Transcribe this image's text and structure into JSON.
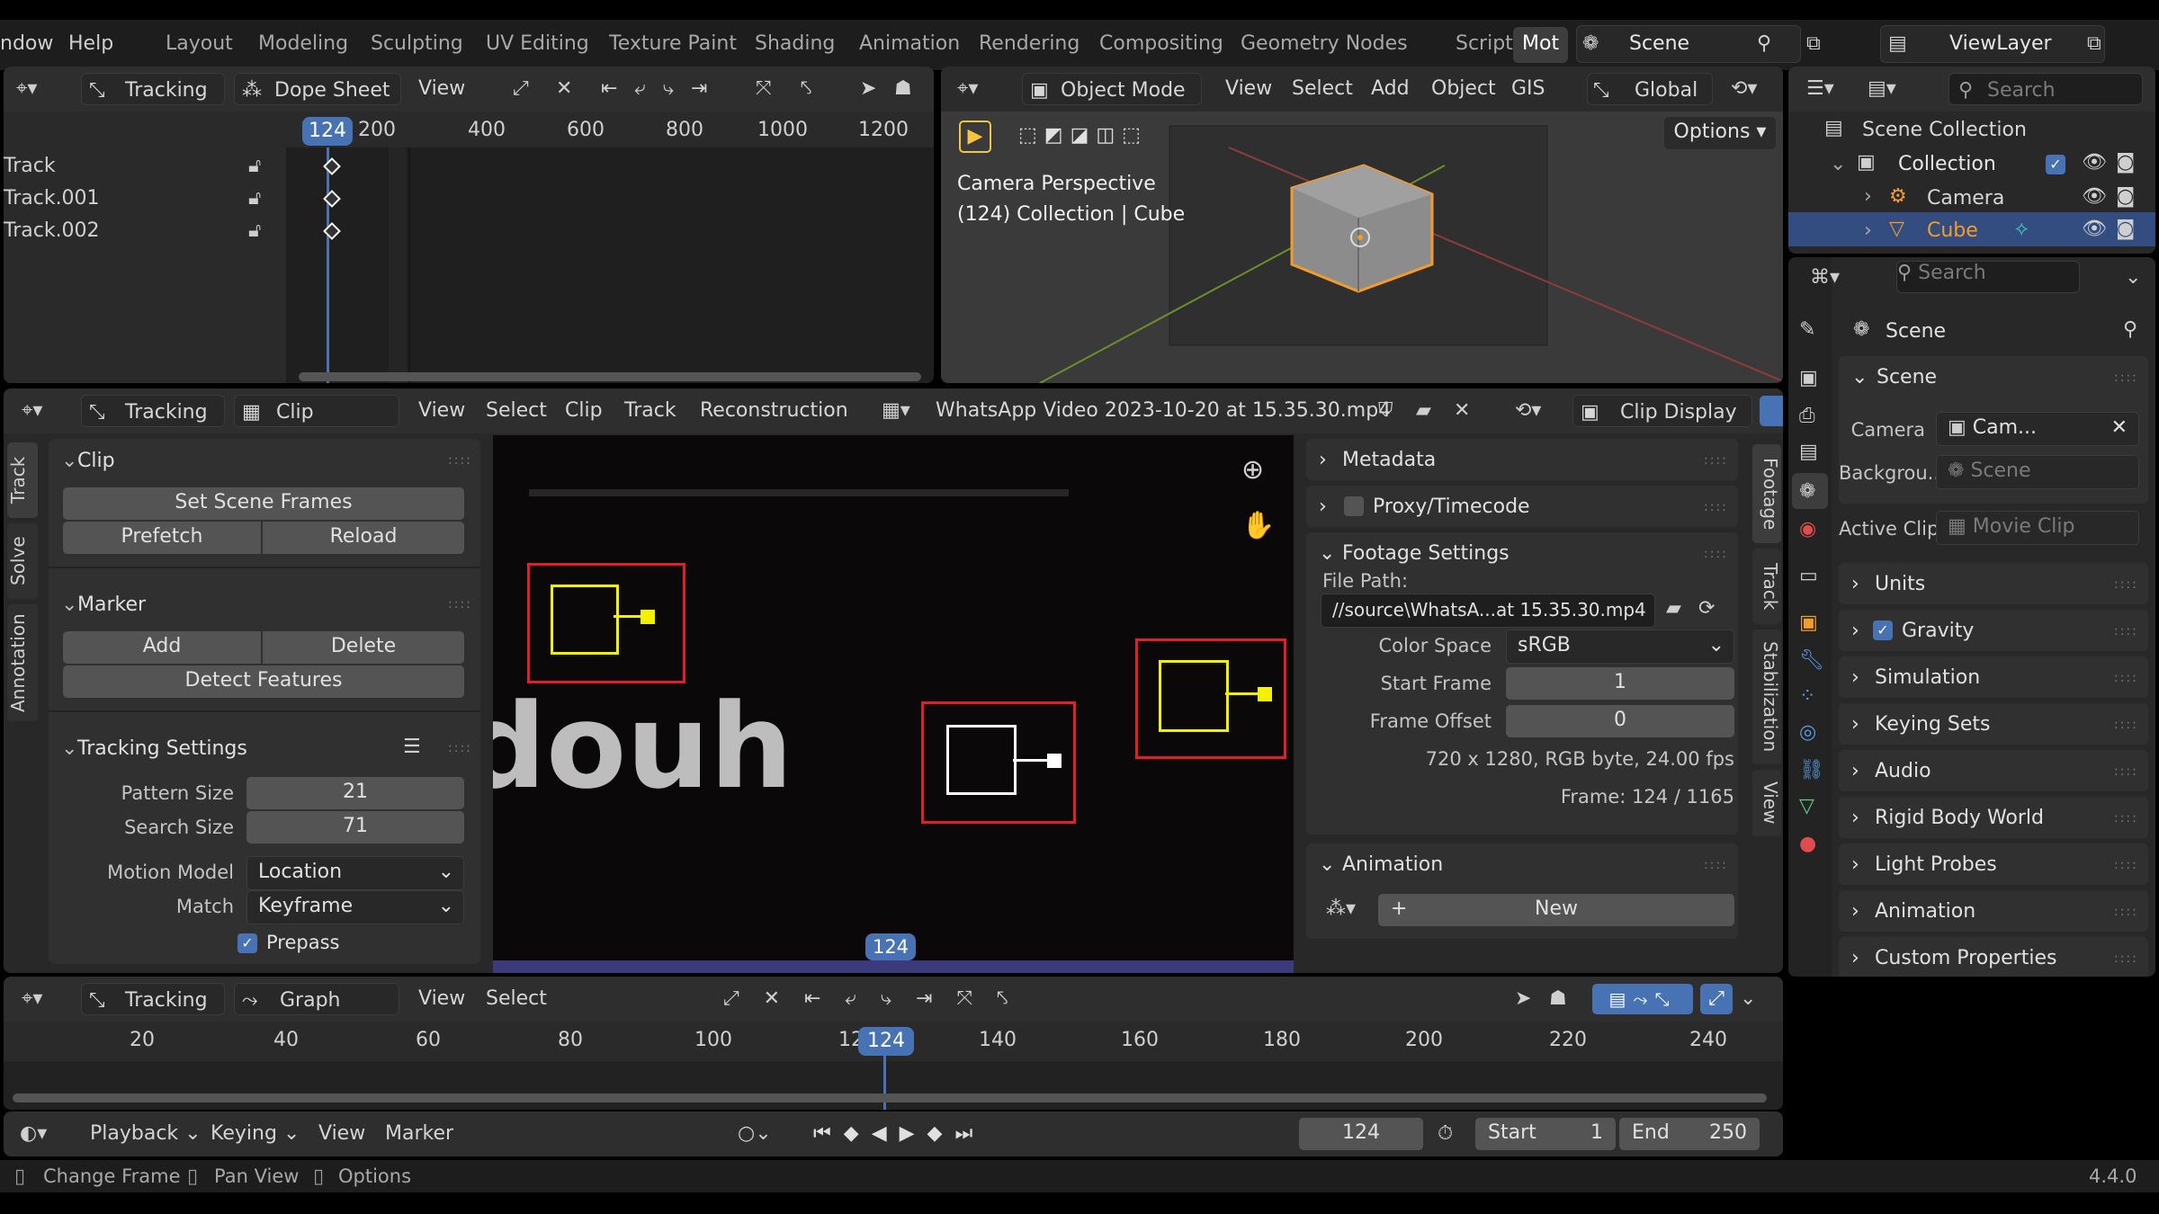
{
  "menus": {
    "window": "ndow",
    "help": "Help"
  },
  "workspaces": [
    "Layout",
    "Modeling",
    "Sculpting",
    "UV Editing",
    "Texture Paint",
    "Shading",
    "Animation",
    "Rendering",
    "Compositing",
    "Geometry Nodes",
    "Scripting",
    "Mot"
  ],
  "scene": {
    "name": "Scene",
    "view_layer": "ViewLayer"
  },
  "dopesheet": {
    "mode": "Tracking",
    "editor": "Dope Sheet",
    "view": "View",
    "ticks": [
      "200",
      "400",
      "600",
      "800",
      "1000",
      "1200"
    ],
    "frame": "124",
    "tracks": [
      "Track",
      "Track.001",
      "Track.002"
    ]
  },
  "viewport": {
    "mode": "Object Mode",
    "menus": [
      "View",
      "Select",
      "Add",
      "Object",
      "GIS"
    ],
    "orientation": "Global",
    "options": "Options",
    "title": "Camera Perspective",
    "subtitle": "(124) Collection | Cube"
  },
  "outliner": {
    "search": "Search",
    "items": [
      "Scene Collection",
      "Collection",
      "Camera",
      "Cube"
    ]
  },
  "clip_editor": {
    "mode": "Tracking",
    "view_type": "Clip",
    "menus": [
      "View",
      "Select",
      "Clip",
      "Track",
      "Reconstruction"
    ],
    "clip_name": "WhatsApp Video 2023-10-20 at 15.35.30.mp4",
    "display": "Clip Display",
    "frame": "124",
    "overlay_text": "douh",
    "side_tabs": [
      "Track",
      "Solve",
      "Annotation"
    ],
    "right_tabs": [
      "Footage",
      "Track",
      "Stabilization",
      "View"
    ],
    "clip_panel": {
      "title": "Clip",
      "set_scene_frames": "Set Scene Frames",
      "prefetch": "Prefetch",
      "reload": "Reload"
    },
    "marker_panel": {
      "title": "Marker",
      "add": "Add",
      "delete": "Delete",
      "detect": "Detect Features"
    },
    "tracking_settings": {
      "title": "Tracking Settings",
      "pattern_size_label": "Pattern Size",
      "pattern_size": "21",
      "search_size_label": "Search Size",
      "search_size": "71",
      "motion_model_label": "Motion Model",
      "motion_model": "Location",
      "match_label": "Match",
      "match": "Keyframe",
      "prepass": "Prepass"
    },
    "footage": {
      "metadata": "Metadata",
      "proxy": "Proxy/Timecode",
      "settings": "Footage Settings",
      "file_path_label": "File Path:",
      "file_path": "//source\\WhatsA...at 15.35.30.mp4",
      "color_space_label": "Color Space",
      "color_space": "sRGB",
      "start_frame_label": "Start Frame",
      "start_frame": "1",
      "frame_offset_label": "Frame Offset",
      "frame_offset": "0",
      "info": "720 x 1280, RGB byte, 24.00 fps",
      "frame_info": "Frame: 124 / 1165",
      "animation": "Animation",
      "new": "New"
    }
  },
  "graph": {
    "mode": "Tracking",
    "editor": "Graph",
    "menus": [
      "View",
      "Select"
    ],
    "ticks": [
      "20",
      "40",
      "60",
      "80",
      "100",
      "12",
      "140",
      "160",
      "180",
      "200",
      "220",
      "240"
    ],
    "frame": "124"
  },
  "timeline": {
    "playback": "Playback",
    "keying": "Keying",
    "view": "View",
    "marker": "Marker",
    "current": "124",
    "start_label": "Start",
    "start": "1",
    "end_label": "End",
    "end": "250"
  },
  "properties": {
    "search": "Search",
    "context": "Scene",
    "section": "Scene",
    "camera_label": "Camera",
    "camera": "Cam...",
    "background_label": "Backgrou...",
    "background": "Scene",
    "active_clip_label": "Active Clip",
    "active_clip": "Movie Clip",
    "panels": [
      "Units",
      "Gravity",
      "Simulation",
      "Keying Sets",
      "Audio",
      "Rigid Body World",
      "Light Probes",
      "Animation",
      "Custom Properties"
    ]
  },
  "status": {
    "change_frame": "Change Frame",
    "pan_view": "Pan View",
    "options": "Options",
    "version": "4.4.0"
  },
  "colors": {
    "accent": "#4772b3",
    "selected_track": "#f1f100",
    "active_box": "#e01f2a"
  }
}
